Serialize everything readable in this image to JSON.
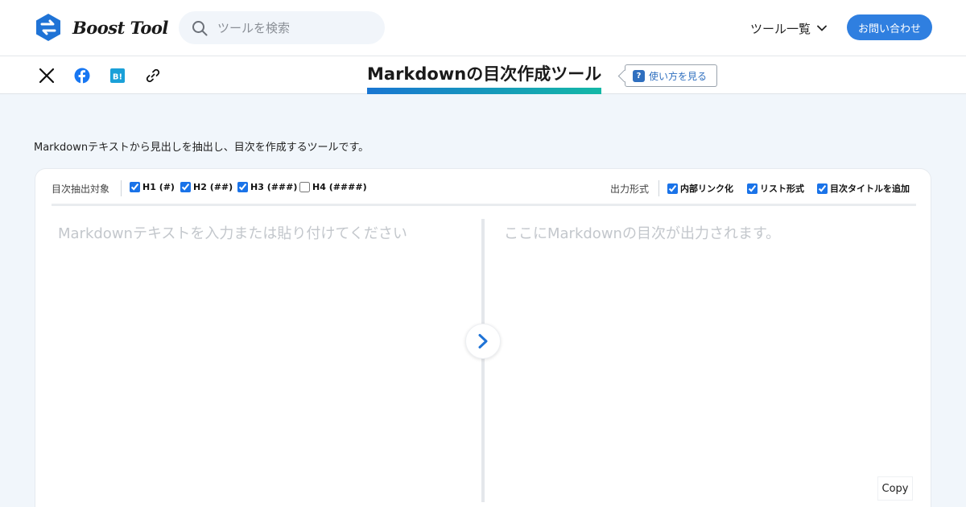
{
  "header": {
    "brand": "Boost Tool",
    "search_placeholder": "ツールを検索",
    "tools_menu": "ツール一覧",
    "contact": "お問い合わせ",
    "accent_color": "#2f7fe0"
  },
  "subbar": {
    "share_icons": [
      "x-icon",
      "facebook-icon",
      "hatena-bookmark-icon",
      "link-icon"
    ],
    "hatena_label": "B!",
    "title": "Markdownの目次作成ツール",
    "howto_badge": "?",
    "howto": "使い方を見る"
  },
  "description": "Markdownテキストから見出しを抽出し、目次を作成するツールです。",
  "options": {
    "target_label": "目次抽出対象",
    "headings": [
      {
        "label": "H1 (#)",
        "checked": true
      },
      {
        "label": "H2 (##)",
        "checked": true
      },
      {
        "label": "H3 (###)",
        "checked": true
      },
      {
        "label": "H4 (####)",
        "checked": false
      }
    ],
    "format_label": "出力形式",
    "formats": [
      {
        "label": "内部リンク化",
        "checked": true
      },
      {
        "label": "リスト形式",
        "checked": true
      },
      {
        "label": "目次タイトルを追加",
        "checked": true
      }
    ]
  },
  "editor": {
    "input_placeholder": "Markdownテキストを入力または貼り付けてください",
    "output_placeholder": "ここにMarkdownの目次が出力されます。",
    "copy": "Copy"
  }
}
